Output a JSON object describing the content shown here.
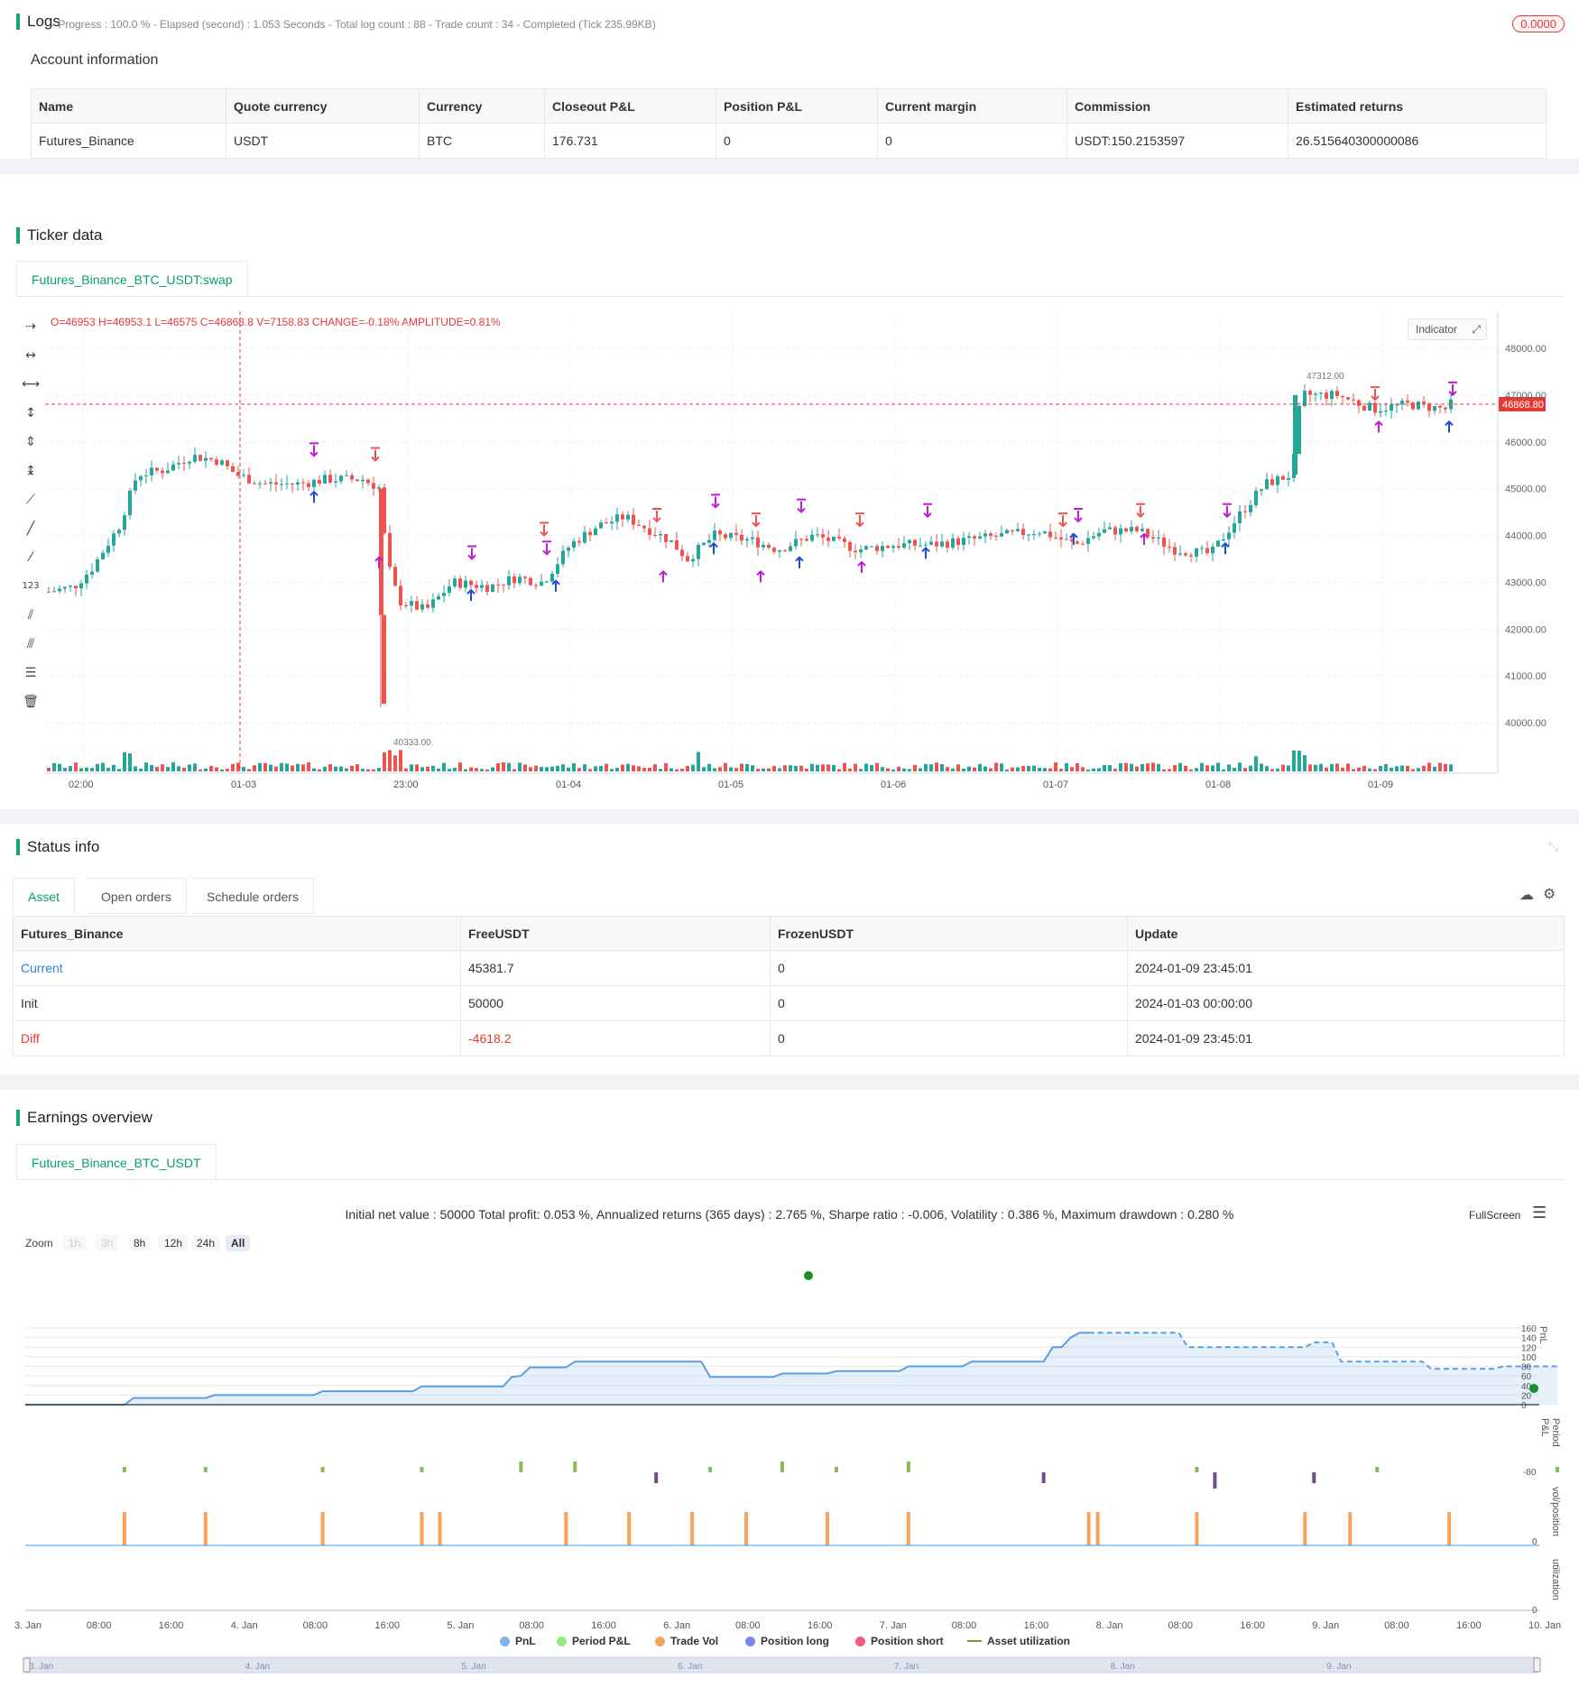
{
  "logs": {
    "title": "Logs",
    "progress": "- Progress : 100.0 % - Elapsed (second) : 1.053  Seconds - Total log count : 88 - Trade count : 34 - Completed (Tick 235.99KB)",
    "badge": "0.0000"
  },
  "account": {
    "title": "Account information",
    "headers": [
      "Name",
      "Quote currency",
      "Currency",
      "Closeout P&L",
      "Position P&L",
      "Current margin",
      "Commission",
      "Estimated returns"
    ],
    "row": [
      "Futures_Binance",
      "USDT",
      "BTC",
      "176.731",
      "0",
      "0",
      "USDT:150.2153597",
      "26.515640300000086"
    ]
  },
  "ticker": {
    "title": "Ticker data",
    "tab": "Futures_Binance_BTC_USDT:swap",
    "ohlc": "O=46953 H=46953.1 L=46575 C=46868.8 V=7158.83 CHANGE=-0.18% AMPLITUDE=0.81%",
    "indicator_btn": "Indicator",
    "price_ticks": [
      "48000.00",
      "47000.00",
      "46000.00",
      "45000.00",
      "44000.00",
      "43000.00",
      "42000.00",
      "41000.00",
      "40000.00"
    ],
    "time_ticks": [
      "02:00",
      "01-03",
      "23:00",
      "01-04",
      "01-05",
      "01-06",
      "01-07",
      "01-08",
      "01-09"
    ],
    "last_price": "46868.80",
    "high_label": "47312.00",
    "low_label": "40333.00",
    "colors": {
      "up": "#26a69a",
      "down": "#ef5350",
      "buy": "#1e4bd8",
      "close": "#c21bd6"
    }
  },
  "status": {
    "title": "Status info",
    "tabs": [
      "Asset",
      "Open orders",
      "Schedule orders"
    ],
    "headers": [
      "Futures_Binance",
      "FreeUSDT",
      "FrozenUSDT",
      "Update"
    ],
    "rows": [
      [
        "Current",
        "45381.7",
        "0",
        "2024-01-09 23:45:01"
      ],
      [
        "Init",
        "50000",
        "0",
        "2024-01-03 00:00:00"
      ],
      [
        "Diff",
        "-4618.2",
        "0",
        "2024-01-09 23:45:01"
      ]
    ]
  },
  "earnings": {
    "title": "Earnings overview",
    "tab": "Futures_Binance_BTC_USDT",
    "summary": "Initial net value : 50000 Total profit: 0.053 %, Annualized returns (365 days) : 2.765 %, Sharpe ratio : -0.006, Volatility : 0.386 %, Maximum drawdown : 0.280 %",
    "fullscreen": "FullScreen",
    "zoom_label": "Zoom",
    "zoom_options": [
      "1h",
      "3h",
      "8h",
      "12h",
      "24h",
      "All"
    ],
    "pnl_ticks": [
      "160",
      "140",
      "120",
      "100",
      "80",
      "60",
      "40",
      "20",
      "0"
    ],
    "axis_titles": [
      "PnL",
      "Period P&L",
      "vol/position",
      "utilization"
    ],
    "period_low": "-80",
    "x_ticks": [
      "3. Jan",
      "08:00",
      "16:00",
      "4. Jan",
      "08:00",
      "16:00",
      "5. Jan",
      "08:00",
      "16:00",
      "6. Jan",
      "08:00",
      "16:00",
      "7. Jan",
      "08:00",
      "16:00",
      "8. Jan",
      "08:00",
      "16:00",
      "9. Jan",
      "08:00",
      "16:00",
      "10. Jan"
    ],
    "nav_ticks": [
      "3. Jan",
      "4. Jan",
      "5. Jan",
      "6. Jan",
      "7. Jan",
      "8. Jan",
      "9. Jan"
    ],
    "legend": [
      {
        "label": "PnL",
        "color": "#7cb5ec"
      },
      {
        "label": "Period P&L",
        "color": "#90ed7d"
      },
      {
        "label": "Trade Vol",
        "color": "#f7a35c"
      },
      {
        "label": "Position long",
        "color": "#8085e9"
      },
      {
        "label": "Position short",
        "color": "#f15c80"
      },
      {
        "label": "Asset utilization",
        "color": "#8d8d3d"
      }
    ]
  },
  "chart_data": {
    "type": "line",
    "title": "",
    "series": [
      {
        "name": "PnL",
        "points_x_hours": [
          0,
          13,
          23,
          25,
          38,
          40,
          53,
          60,
          67,
          72,
          77,
          82,
          93,
          99,
          107,
          110,
          117,
          126,
          133,
          143,
          146,
          150,
          154,
          169,
          171,
          174,
          180,
          181,
          191,
          202,
          205,
          208,
          218,
          226,
          229,
          238,
          240,
          241,
          250,
          252,
          259,
          262,
          275,
          280,
          282,
          287
        ],
        "values": [
          0,
          0,
          0,
          14,
          14,
          20,
          20,
          28,
          28,
          38,
          38,
          38,
          60,
          78,
          90,
          90,
          90,
          90,
          90,
          58,
          58,
          58,
          65,
          65,
          70,
          80,
          80,
          90,
          90,
          100,
          100,
          110,
          110,
          120,
          150,
          150,
          150,
          150,
          120,
          120,
          120,
          120,
          120,
          120,
          130,
          130
        ]
      },
      {
        "name": "Trade Vol",
        "values": []
      }
    ],
    "ylim": [
      0,
      170
    ]
  }
}
